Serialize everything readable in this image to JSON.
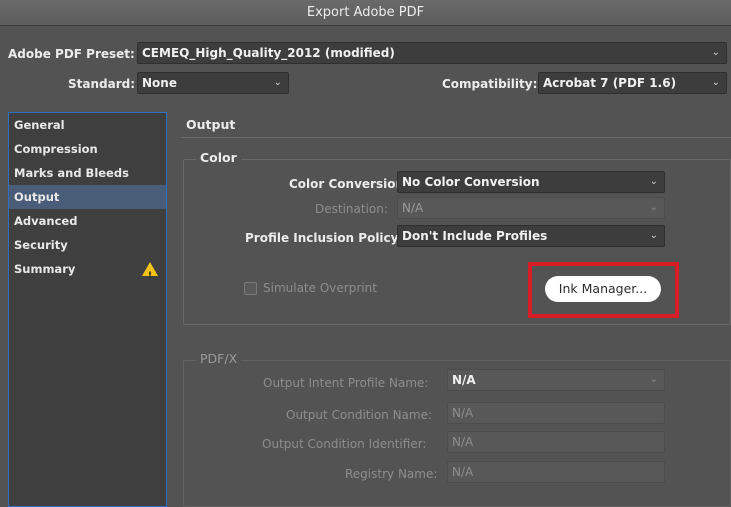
{
  "window": {
    "title": "Export Adobe PDF"
  },
  "preset": {
    "label": "Adobe PDF Preset:",
    "value": "CEMEQ_High_Quality_2012 (modified)"
  },
  "standard": {
    "label": "Standard:",
    "value": "None"
  },
  "compatibility": {
    "label": "Compatibility:",
    "value": "Acrobat 7 (PDF 1.6)"
  },
  "sidebar": {
    "items": [
      {
        "label": "General"
      },
      {
        "label": "Compression"
      },
      {
        "label": "Marks and Bleeds"
      },
      {
        "label": "Output"
      },
      {
        "label": "Advanced"
      },
      {
        "label": "Security"
      },
      {
        "label": "Summary"
      }
    ],
    "active": "Output"
  },
  "main": {
    "section_title": "Output",
    "color_group": {
      "title": "Color",
      "color_conversion": {
        "label": "Color Conversion:",
        "value": "No Color Conversion"
      },
      "destination": {
        "label": "Destination:",
        "value": "N/A"
      },
      "profile_policy": {
        "label": "Profile Inclusion Policy:",
        "value": "Don't Include Profiles"
      },
      "simulate_overprint": {
        "label": "Simulate Overprint"
      },
      "ink_manager": {
        "label": "Ink Manager..."
      }
    },
    "pdfx_group": {
      "title": "PDF/X",
      "output_intent": {
        "label": "Output Intent Profile Name:",
        "value": "N/A"
      },
      "output_condition_name": {
        "label": "Output Condition Name:",
        "value": "N/A"
      },
      "output_condition_identifier": {
        "label": "Output Condition Identifier:",
        "value": "N/A"
      },
      "registry_name": {
        "label": "Registry Name:",
        "value": "N/A"
      }
    }
  },
  "colors": {
    "highlight": "#d71e27",
    "warning": "#f2c318",
    "sidebar_active": "#4a5d78",
    "sidebar_border": "#2e6fbf"
  }
}
